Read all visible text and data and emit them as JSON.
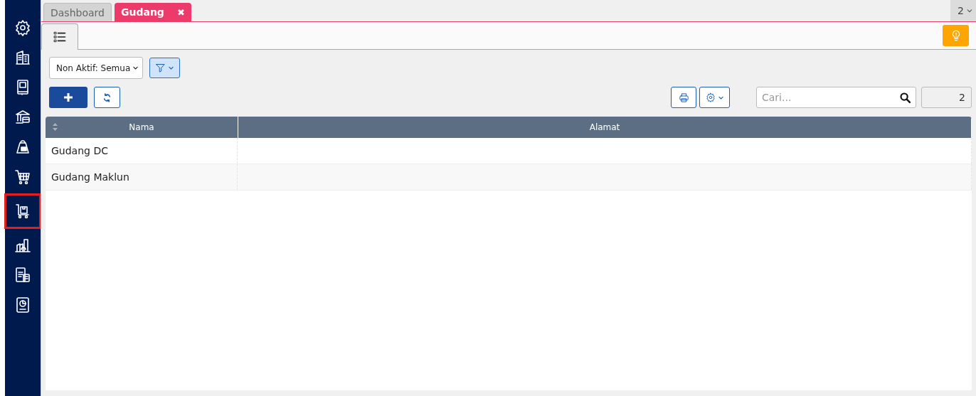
{
  "sidebar": {
    "items": [
      {
        "selected": false
      },
      {
        "selected": false
      },
      {
        "selected": false
      },
      {
        "selected": false
      },
      {
        "selected": false
      },
      {
        "selected": false
      },
      {
        "selected": true
      },
      {
        "selected": false
      },
      {
        "selected": false
      },
      {
        "selected": false
      }
    ]
  },
  "tabs": [
    {
      "label": "Dashboard",
      "selected": false,
      "closable": false
    },
    {
      "label": "Gudang",
      "selected": true,
      "closable": true,
      "close": "✖"
    }
  ],
  "tab_count": "2",
  "filters": {
    "status": "Non Aktif: Semua"
  },
  "search": {
    "placeholder": "Cari..."
  },
  "record_count": "2",
  "table": {
    "columns": [
      {
        "label": "Nama",
        "sortable": true
      },
      {
        "label": "Alamat",
        "sortable": false
      }
    ],
    "rows": [
      [
        "Gudang DC",
        ""
      ],
      [
        "Gudang Maklun",
        ""
      ]
    ]
  }
}
